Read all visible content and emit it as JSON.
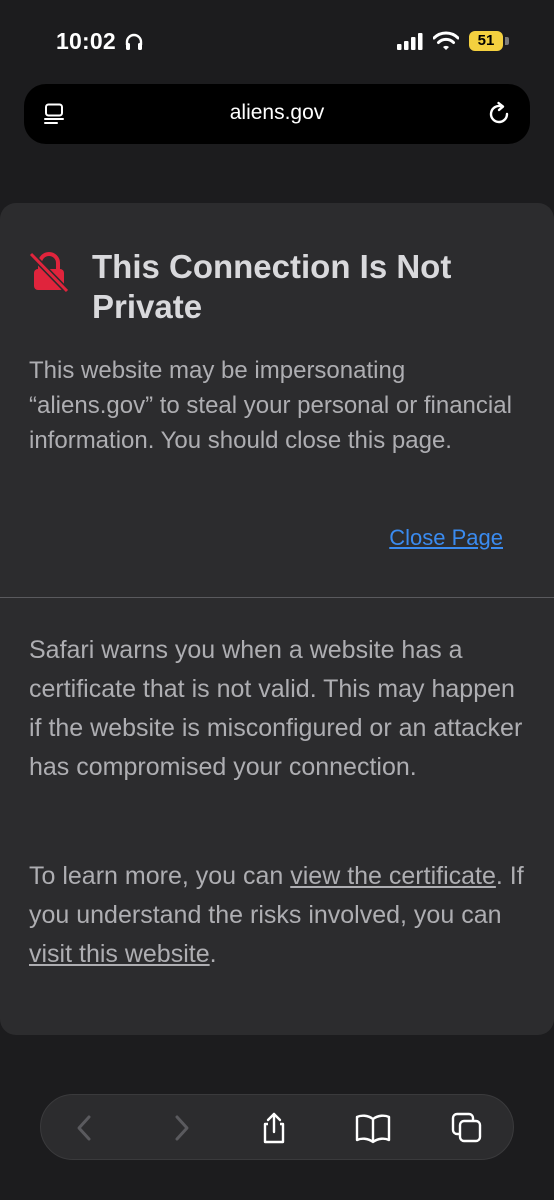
{
  "status_bar": {
    "time": "10:02",
    "battery": "51"
  },
  "address_bar": {
    "url": "aliens.gov"
  },
  "warning": {
    "title": "This Connection Is Not Private",
    "description": "This website may be impersonating “aliens.gov” to steal your personal or financial information. You should close this page.",
    "close_label": "Close Page",
    "details": "Safari warns you when a website has a certificate that is not valid. This may happen if the website is misconfigured or an attacker has compromised your connection.",
    "learn_prefix": "To learn more, you can ",
    "view_cert_label": "view the certificate",
    "learn_middle": ". If you understand the risks involved, you can ",
    "visit_label": "visit this website",
    "learn_suffix": "."
  },
  "toolbar": {
    "icons": [
      "back-icon",
      "forward-icon",
      "share-icon",
      "bookmarks-icon",
      "tabs-icon"
    ]
  },
  "colors": {
    "background": "#1c1c1e",
    "card": "#2c2c2e",
    "link_blue": "#3a8bf0",
    "lock_red": "#e0243c",
    "battery_yellow": "#f4d03f"
  }
}
